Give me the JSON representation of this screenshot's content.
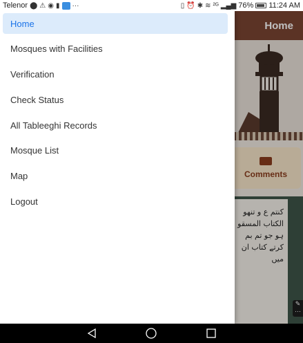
{
  "status_bar": {
    "carrier": "Telenor",
    "left_icons": [
      "alert-icon",
      "warning-icon",
      "messenger-icon",
      "notification-icon",
      "app-icon",
      "more-icon"
    ],
    "more": "···",
    "right_icons": [
      "vibrate-icon",
      "alarm-icon",
      "signal-icon",
      "wifi-icon"
    ],
    "network": "²ᴳ",
    "battery_percent": "76%",
    "time": "11:24 AM"
  },
  "app": {
    "header_title": "Home",
    "comments_label": "Comments",
    "urdu_text": "کنتم ع و تنهو الکتاب المسقو ہو جو تم بم کرتے کتاب ان میں"
  },
  "drawer": {
    "items": [
      {
        "label": "Home",
        "active": true
      },
      {
        "label": "Mosques with Facilities",
        "active": false
      },
      {
        "label": "Verification",
        "active": false
      },
      {
        "label": "Check Status",
        "active": false
      },
      {
        "label": "All Tableeghi Records",
        "active": false
      },
      {
        "label": "Mosque List",
        "active": false
      },
      {
        "label": "Map",
        "active": false
      },
      {
        "label": "Logout",
        "active": false
      }
    ]
  },
  "nav_bar": {
    "buttons": [
      "back-icon",
      "home-icon",
      "recents-icon"
    ]
  },
  "colors": {
    "header_brown": "#7a4432",
    "active_item_bg": "#dcebfb",
    "active_item_text": "#1a73e8",
    "panel_green": "#3e5448"
  }
}
